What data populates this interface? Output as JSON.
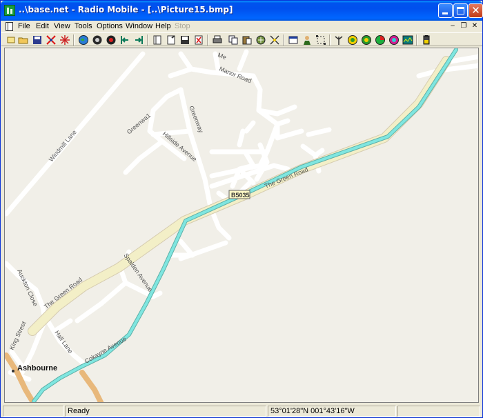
{
  "window": {
    "title": "..\\base.net - Radio Mobile - [..\\Picture15.bmp]"
  },
  "menu": [
    {
      "label": "File",
      "name": "menu-file",
      "disabled": false
    },
    {
      "label": "Edit",
      "name": "menu-edit",
      "disabled": false
    },
    {
      "label": "View",
      "name": "menu-view",
      "disabled": false
    },
    {
      "label": "Tools",
      "name": "menu-tools",
      "disabled": false
    },
    {
      "label": "Options",
      "name": "menu-options",
      "disabled": false
    },
    {
      "label": "Window",
      "name": "menu-window",
      "disabled": false
    },
    {
      "label": "Help",
      "name": "menu-help",
      "disabled": false
    },
    {
      "label": "Stop",
      "name": "menu-stop",
      "disabled": true
    }
  ],
  "toolbar_icons": [
    "new-icon",
    "open-folder-icon",
    "save-icon",
    "cut-network-icon",
    "star-network-icon",
    "globe-icon",
    "gear-globe-icon",
    "target-globe-icon",
    "step-left-icon",
    "step-right-icon",
    "page-icon",
    "page-edit-icon",
    "floppy-icon",
    "pdf-icon",
    "printer-icon",
    "copy-icon",
    "paste-icon",
    "map-properties-icon",
    "merge-icon",
    "window-icon",
    "person-icon",
    "selection-icon",
    "antenna-icon",
    "radio-link-icon",
    "radio-coverage-icon",
    "polar-coverage-icon",
    "rainbow-icon",
    "spectrum-icon",
    "battery-icon"
  ],
  "map": {
    "labels": {
      "manor_road": "Manor Road",
      "me": "Me",
      "greenway": "Greenway",
      "greenway1": "Greenwa1",
      "hillside": "Hillside Avenue",
      "windmill": "Windmill Lane",
      "green_road_upper": "The Green Road",
      "green_road_lower": "The Green Road",
      "road_badge": "B5035",
      "spalden": "Spalden Avenue",
      "auckton": "Auckton Close",
      "king_street": "King Street",
      "hall_lane": "Hall Lane",
      "cokayne": "Cokayne Avenue",
      "town": "Ashbourne"
    }
  },
  "status": {
    "left": "",
    "message": "Ready",
    "coords": "53°01'28\"N 001°43'16\"W",
    "right": ""
  },
  "colors": {
    "title_bar": "#0054e3",
    "map_background": "#f1efe8",
    "route": "#7fe6e0",
    "main_road": "#f3efc7",
    "b_road": "#e8b87b"
  }
}
